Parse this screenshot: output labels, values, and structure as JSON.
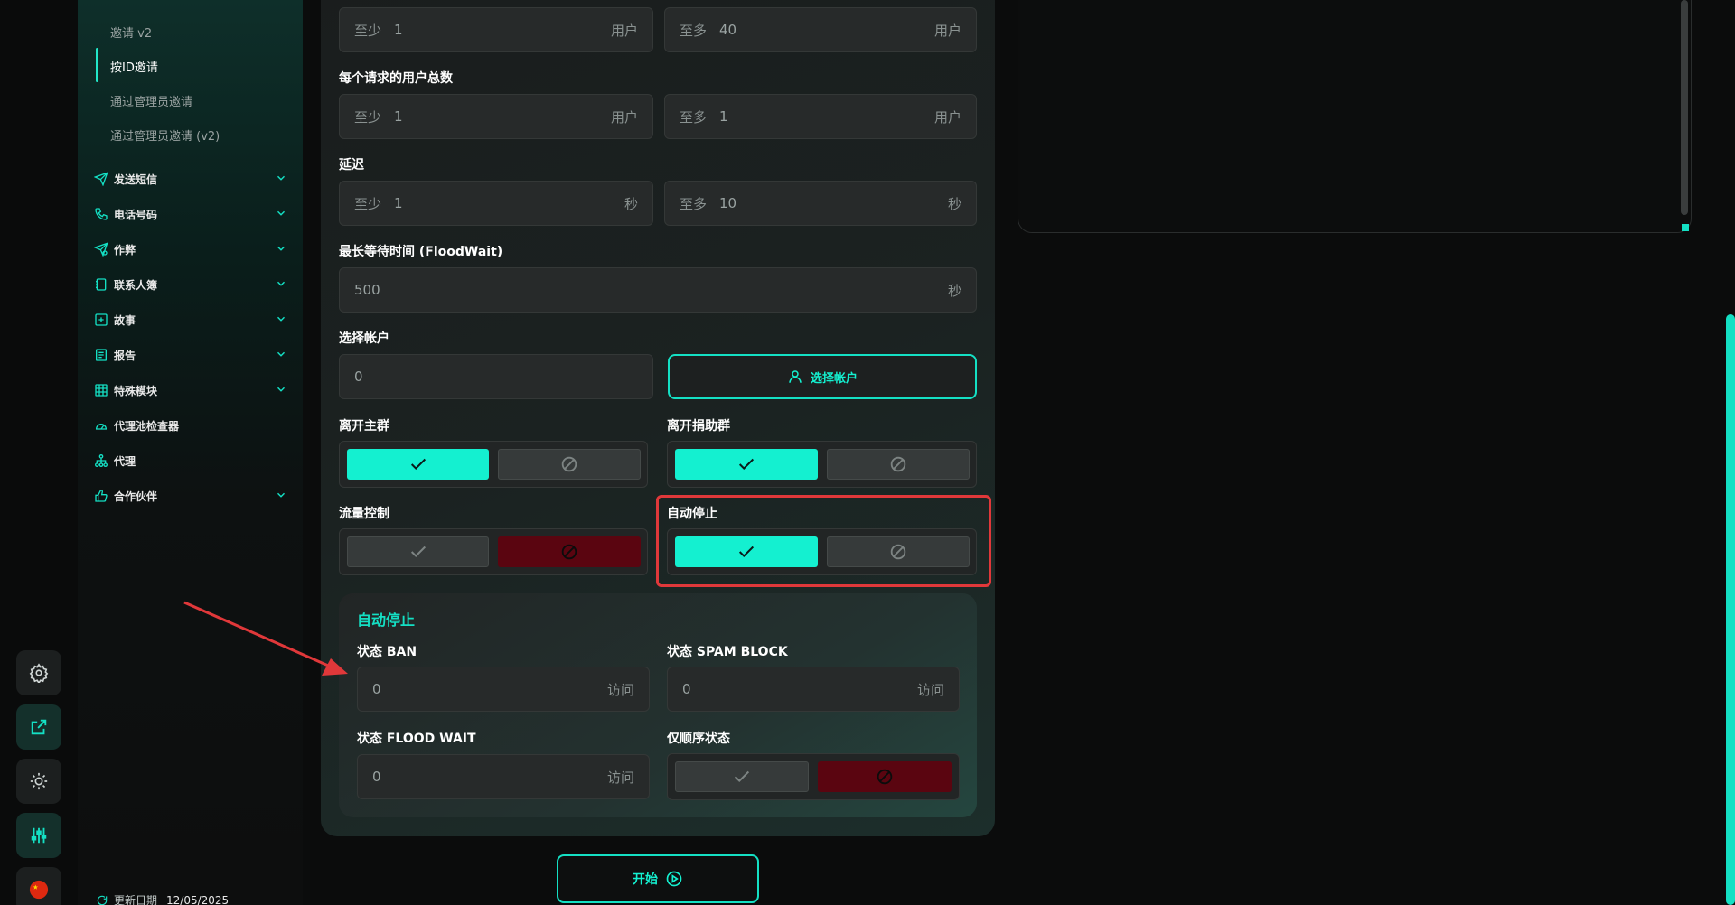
{
  "sidebar": {
    "sub_items": [
      "邀请 v2",
      "按ID邀请",
      "通过管理员邀请",
      "通过管理员邀请 (v2)"
    ],
    "nav_items": [
      "发送短信",
      "电话号码",
      "作弊",
      "联系人簿",
      "故事",
      "报告",
      "特殊模块",
      "代理池检查器",
      "代理",
      "合作伙伴"
    ],
    "update_label": "更新日期",
    "update_date": "12/05/2025"
  },
  "form": {
    "row1": {
      "min_prefix": "至少",
      "min_value": "1",
      "min_unit": "用户",
      "max_prefix": "至多",
      "max_value": "40",
      "max_unit": "用户"
    },
    "users_per_request": {
      "label": "每个请求的用户总数",
      "min_prefix": "至少",
      "min_value": "1",
      "min_unit": "用户",
      "max_prefix": "至多",
      "max_value": "1",
      "max_unit": "用户"
    },
    "delay": {
      "label": "延迟",
      "min_prefix": "至少",
      "min_value": "1",
      "min_unit": "秒",
      "max_prefix": "至多",
      "max_value": "10",
      "max_unit": "秒"
    },
    "floodwait": {
      "label": "最长等待时间 (FloodWait)",
      "value": "500",
      "unit": "秒"
    },
    "accounts": {
      "label": "选择帐户",
      "value": "0",
      "button": "选择帐户"
    },
    "leave_main": {
      "label": "离开主群",
      "state": "on"
    },
    "leave_donor": {
      "label": "离开捐助群",
      "state": "on"
    },
    "flow_control": {
      "label": "流量控制",
      "state": "off"
    },
    "auto_stop": {
      "label": "自动停止",
      "state": "on"
    }
  },
  "autostop_panel": {
    "title": "自动停止",
    "ban": {
      "label": "状态 BAN",
      "value": "0",
      "unit": "访问"
    },
    "spam_block": {
      "label": "状态 SPAM BLOCK",
      "value": "0",
      "unit": "访问"
    },
    "flood_wait": {
      "label": "状态 FLOOD WAIT",
      "value": "0",
      "unit": "访问"
    },
    "sequential": {
      "label": "仅顺序状态",
      "state": "off"
    }
  },
  "start_button": "开始",
  "colors": {
    "accent": "#14f0d0",
    "danger": "#5a0510",
    "highlight": "#e0383a"
  }
}
